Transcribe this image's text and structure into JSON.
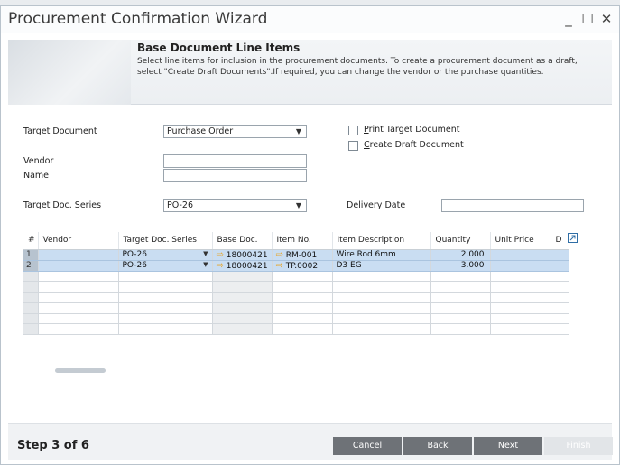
{
  "window": {
    "title": "Procurement Confirmation Wizard",
    "minimize_glyph": "_",
    "maximize_glyph": "☐",
    "close_glyph": "✕"
  },
  "header": {
    "title": "Base Document Line Items",
    "description": "Select line items for inclusion in the procurement documents. To create a procurement document as a draft, select \"Create Draft Documents\".If required, you can change the vendor or the purchase quantities."
  },
  "form": {
    "target_document_label": "Target Document",
    "target_document_value": "Purchase Order",
    "vendor_label": "Vendor",
    "vendor_value": "",
    "name_label": "Name",
    "name_value": "",
    "target_doc_series_label": "Target Doc. Series",
    "target_doc_series_value": "PO-26",
    "delivery_date_label": "Delivery Date",
    "delivery_date_value": "",
    "print_target_label_u": "P",
    "print_target_label_rest": "rint Target Document",
    "create_draft_label_u": "C",
    "create_draft_label_rest": "reate Draft Document",
    "print_target_checked": false,
    "create_draft_checked": false
  },
  "grid": {
    "columns": [
      "#",
      "Vendor",
      "Target Doc. Series",
      "Base Doc.",
      "Item No.",
      "Item Description",
      "Quantity",
      "Unit Price",
      "D"
    ],
    "rows": [
      {
        "num": "1",
        "vendor": "",
        "series": "PO-26",
        "base_doc": "18000421",
        "item_no": "RM-001",
        "description": "Wire Rod 6mm",
        "quantity": "2.000",
        "unit_price": "",
        "d": ""
      },
      {
        "num": "2",
        "vendor": "",
        "series": "PO-26",
        "base_doc": "18000421",
        "item_no": "TP.0002",
        "description": "D3 EG",
        "quantity": "3.000",
        "unit_price": "",
        "d": ""
      }
    ],
    "arrow_glyph": "⇨",
    "dropdown_glyph": "▼"
  },
  "footer": {
    "step_text": "Step 3 of 6",
    "cancel_label": "Cancel",
    "back_label": "Back",
    "next_label": "Next",
    "finish_label": "Finish"
  },
  "colors": {
    "selected_row": "#c9ddf2",
    "button": "#6e7277",
    "link_arrow": "#e7a52a"
  }
}
